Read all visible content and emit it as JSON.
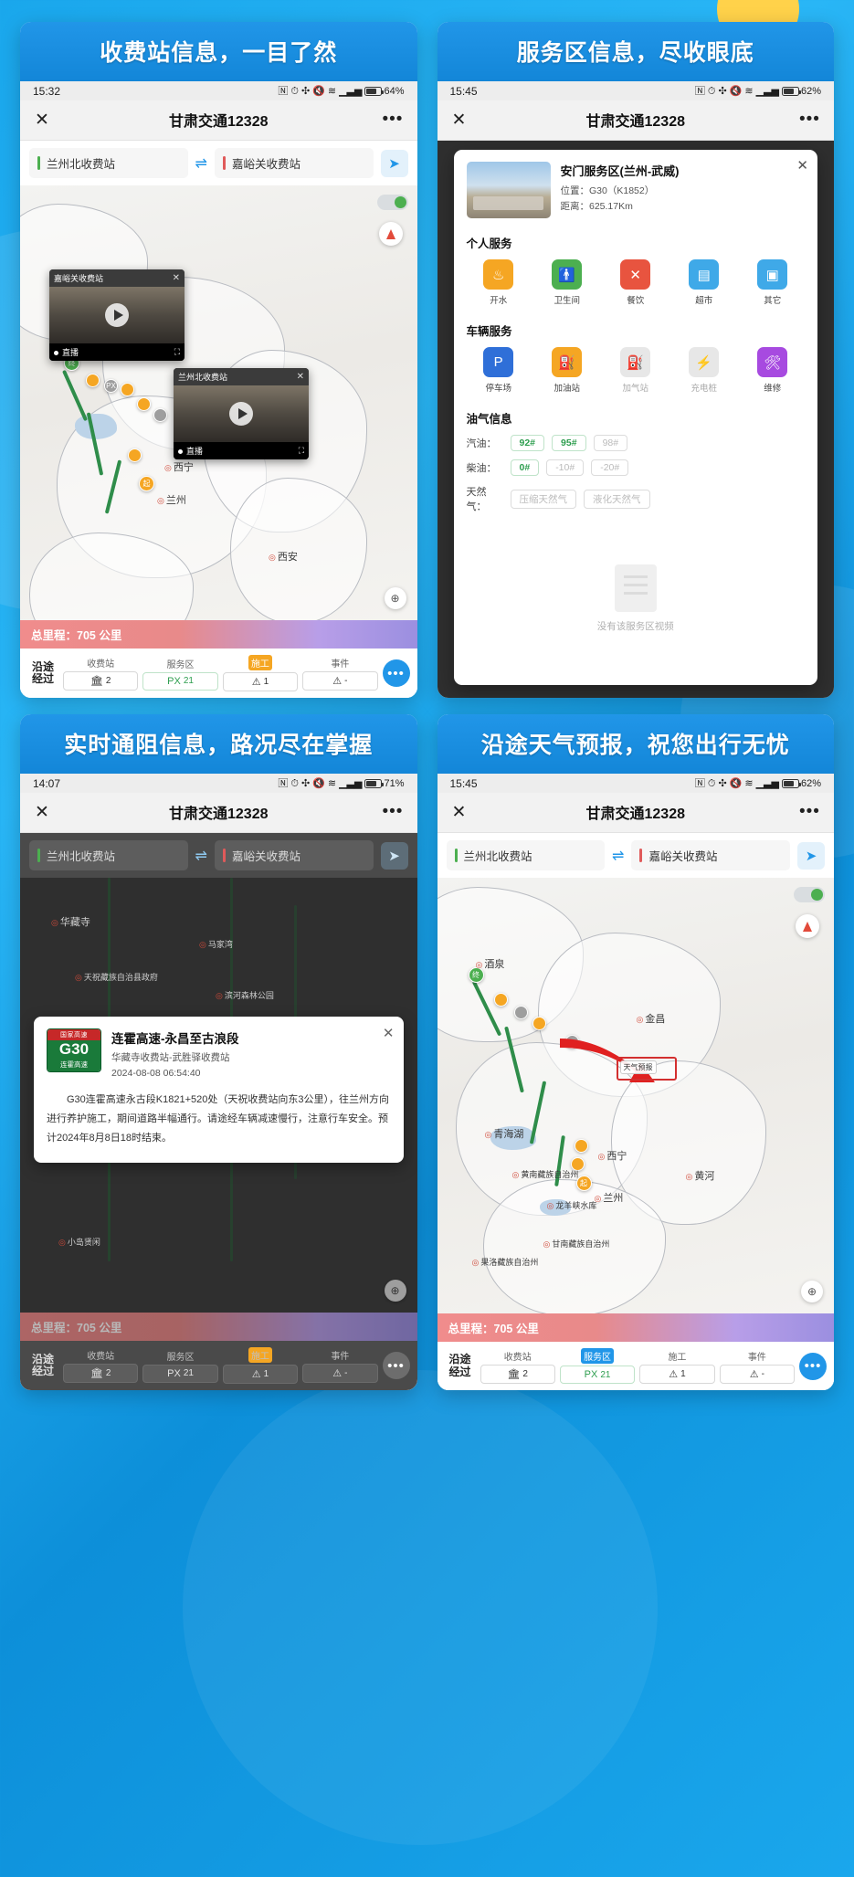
{
  "panels": [
    {
      "banner": "收费站信息，一目了然",
      "status": {
        "time": "15:32",
        "battery": "64%"
      },
      "nav": {
        "title": "甘肃交通12328",
        "close": "✕",
        "more": "•••"
      },
      "route": {
        "origin": "兰州北收费站",
        "destination": "嘉峪关收费站",
        "swap": "⇌",
        "send": "➤"
      },
      "map": {
        "cities": [
          "西宁",
          "兰州",
          "西安"
        ],
        "live_cards": [
          {
            "title": "嘉峪关收费站",
            "close": "✕",
            "live": "直播"
          },
          {
            "title": "兰州北收费站",
            "close": "✕",
            "live": "直播"
          }
        ]
      },
      "mileage": "总里程：705 公里",
      "tabs": {
        "lead": "沿途\n经过",
        "items": [
          {
            "label": "收费站",
            "value": "2",
            "icon": "tollgate-icon",
            "active": false
          },
          {
            "label": "服务区",
            "value": "21",
            "icon": "PX",
            "active": false
          },
          {
            "label": "施工",
            "value": "1",
            "icon": "⚠",
            "active": true,
            "color": "orange"
          },
          {
            "label": "事件",
            "value": "-",
            "icon": "⚠",
            "active": false
          }
        ],
        "more": "•••"
      }
    },
    {
      "banner": "服务区信息，尽收眼底",
      "status": {
        "time": "15:45",
        "battery": "62%"
      },
      "nav": {
        "title": "甘肃交通12328",
        "close": "✕",
        "more": "•••"
      },
      "modal": {
        "close": "✕",
        "name": "安门服务区(兰州-武威)",
        "location_label": "位置：",
        "location": "G30（K1852）",
        "distance_label": "距离：",
        "distance": "625.17Km",
        "sections": [
          {
            "title": "个人服务",
            "items": [
              {
                "caption": "开水",
                "icon": "water-icon",
                "color": "#f5a623",
                "enabled": true
              },
              {
                "caption": "卫生间",
                "icon": "restroom-icon",
                "color": "#4caf50",
                "enabled": true
              },
              {
                "caption": "餐饮",
                "icon": "dining-icon",
                "color": "#e8543f",
                "enabled": true
              },
              {
                "caption": "超市",
                "icon": "market-icon",
                "color": "#3fa9e8",
                "enabled": true
              },
              {
                "caption": "其它",
                "icon": "other-icon",
                "color": "#3fa9e8",
                "enabled": true
              }
            ]
          },
          {
            "title": "车辆服务",
            "items": [
              {
                "caption": "停车场",
                "icon": "parking-icon",
                "color": "#2f6fd8",
                "enabled": true
              },
              {
                "caption": "加油站",
                "icon": "gas-station-icon",
                "color": "#f5a623",
                "enabled": true
              },
              {
                "caption": "加气站",
                "icon": "gas-fill-icon",
                "color": "#e7e7e7",
                "enabled": false
              },
              {
                "caption": "充电桩",
                "icon": "charging-icon",
                "color": "#e7e7e7",
                "enabled": false
              },
              {
                "caption": "维修",
                "icon": "repair-icon",
                "color": "#a74ae0",
                "enabled": true
              }
            ]
          }
        ],
        "fuel_title": "油气信息",
        "fuel_rows": [
          {
            "label": "汽油：",
            "chips": [
              {
                "text": "92#",
                "on": true
              },
              {
                "text": "95#",
                "on": true
              },
              {
                "text": "98#",
                "on": false
              }
            ]
          },
          {
            "label": "柴油：",
            "chips": [
              {
                "text": "0#",
                "on": true
              },
              {
                "text": "-10#",
                "on": false
              },
              {
                "text": "-20#",
                "on": false
              }
            ]
          },
          {
            "label": "天然气：",
            "chips": [
              {
                "text": "压缩天然气",
                "on": false
              },
              {
                "text": "液化天然气",
                "on": false
              }
            ]
          }
        ],
        "no_video": "没有该服务区视频"
      }
    },
    {
      "banner": "实时通阻信息，路况尽在掌握",
      "status": {
        "time": "14:07",
        "battery": "71%"
      },
      "nav": {
        "title": "甘肃交通12328",
        "close": "✕",
        "more": "•••"
      },
      "route": {
        "origin": "兰州北收费站",
        "destination": "嘉峪关收费站",
        "swap": "⇌",
        "send": "➤"
      },
      "map": {
        "cities": [
          "华藏寺",
          "天祝藏族自治县政府",
          "马家湾",
          "滨河森林公园",
          "小岛贤闲"
        ]
      },
      "notice": {
        "close": "✕",
        "shield_top": "国家高速",
        "shield_code": "G30",
        "shield_bottom": "连霍高速",
        "title": "连霍高速-永昌至古浪段",
        "segment": "华藏寺收费站-武胜驿收费站",
        "time": "2024-08-08 06:54:40",
        "body": "G30连霍高速永古段K1821+520处（天祝收费站向东3公里），往兰州方向进行养护施工，期间道路半幅通行。请途经车辆减速慢行，注意行车安全。预计2024年8月8日18时结束。"
      },
      "mileage": "总里程：705 公里",
      "tabs": {
        "lead": "沿途\n经过",
        "items": [
          {
            "label": "收费站",
            "value": "2",
            "icon": "tollgate-icon",
            "active": false
          },
          {
            "label": "服务区",
            "value": "21",
            "icon": "PX",
            "active": false
          },
          {
            "label": "施工",
            "value": "1",
            "icon": "⚠",
            "active": true,
            "color": "orange"
          },
          {
            "label": "事件",
            "value": "-",
            "icon": "⚠",
            "active": false
          }
        ],
        "more": "•••"
      }
    },
    {
      "banner": "沿途天气预报，祝您出行无忧",
      "status": {
        "time": "15:45",
        "battery": "62%"
      },
      "nav": {
        "title": "甘肃交通12328",
        "close": "✕",
        "more": "•••"
      },
      "route": {
        "origin": "兰州北收费站",
        "destination": "嘉峪关收费站",
        "swap": "⇌",
        "send": "➤"
      },
      "map": {
        "cities": [
          "酒泉",
          "金昌",
          "西宁",
          "兰州",
          "黄河",
          "青海湖",
          "龙羊峡水库",
          "黄南藏族自治州",
          "甘南藏族自治州",
          "果洛藏族自治州"
        ],
        "highlight": "天气预报"
      },
      "mileage": "总里程：705 公里",
      "tabs": {
        "lead": "沿途\n经过",
        "items": [
          {
            "label": "收费站",
            "value": "2",
            "icon": "tollgate-icon",
            "active": false
          },
          {
            "label": "服务区",
            "value": "21",
            "icon": "PX",
            "active": true,
            "color": "blue"
          },
          {
            "label": "施工",
            "value": "1",
            "icon": "⚠",
            "active": false
          },
          {
            "label": "事件",
            "value": "-",
            "icon": "⚠",
            "active": false
          }
        ],
        "more": "•••"
      }
    }
  ],
  "colors": {
    "brand": "#2196e8",
    "banner": "#1386d8",
    "accent_green": "#4caf50",
    "accent_orange": "#f5a623",
    "accent_red": "#d32f2f"
  }
}
